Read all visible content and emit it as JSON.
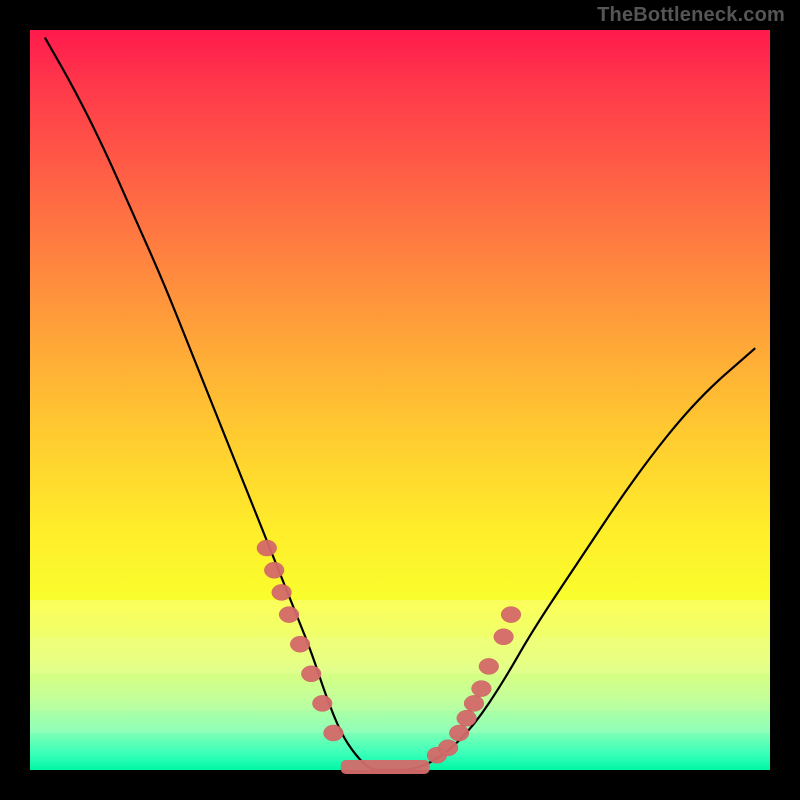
{
  "attribution": "TheBottleneck.com",
  "chart_data": {
    "type": "line",
    "title": "",
    "xlabel": "",
    "ylabel": "",
    "xlim": [
      0,
      100
    ],
    "ylim": [
      0,
      100
    ],
    "grid": false,
    "background_gradient": {
      "from": "#ff1a4d",
      "to": "#00f7a5",
      "direction": "top-to-bottom"
    },
    "series": [
      {
        "name": "bottleneck-curve",
        "x": [
          2,
          6,
          10,
          14,
          18,
          22,
          26,
          30,
          34,
          36,
          38,
          40,
          42,
          44,
          46,
          48,
          52,
          56,
          60,
          64,
          68,
          74,
          82,
          90,
          98
        ],
        "y": [
          99,
          92,
          84,
          75,
          66,
          56,
          46,
          36,
          26,
          21,
          16,
          10,
          5,
          2,
          0,
          0,
          0,
          2,
          6,
          12,
          19,
          28,
          40,
          50,
          57
        ],
        "color": "#000000"
      }
    ],
    "markers": {
      "name": "highlight-knots",
      "color": "#d46a6a",
      "radius_approx": 1.2,
      "points": [
        {
          "x": 32,
          "y": 30
        },
        {
          "x": 33,
          "y": 27
        },
        {
          "x": 34,
          "y": 24
        },
        {
          "x": 35,
          "y": 21
        },
        {
          "x": 36.5,
          "y": 17
        },
        {
          "x": 38,
          "y": 13
        },
        {
          "x": 39.5,
          "y": 9
        },
        {
          "x": 41,
          "y": 5
        },
        {
          "x": 55,
          "y": 2
        },
        {
          "x": 56.5,
          "y": 3
        },
        {
          "x": 58,
          "y": 5
        },
        {
          "x": 59,
          "y": 7
        },
        {
          "x": 60,
          "y": 9
        },
        {
          "x": 61,
          "y": 11
        },
        {
          "x": 62,
          "y": 14
        },
        {
          "x": 64,
          "y": 18
        },
        {
          "x": 65,
          "y": 21
        }
      ],
      "trough_bar": {
        "x0": 42,
        "x1": 54,
        "y": 0
      }
    },
    "annotations": []
  }
}
